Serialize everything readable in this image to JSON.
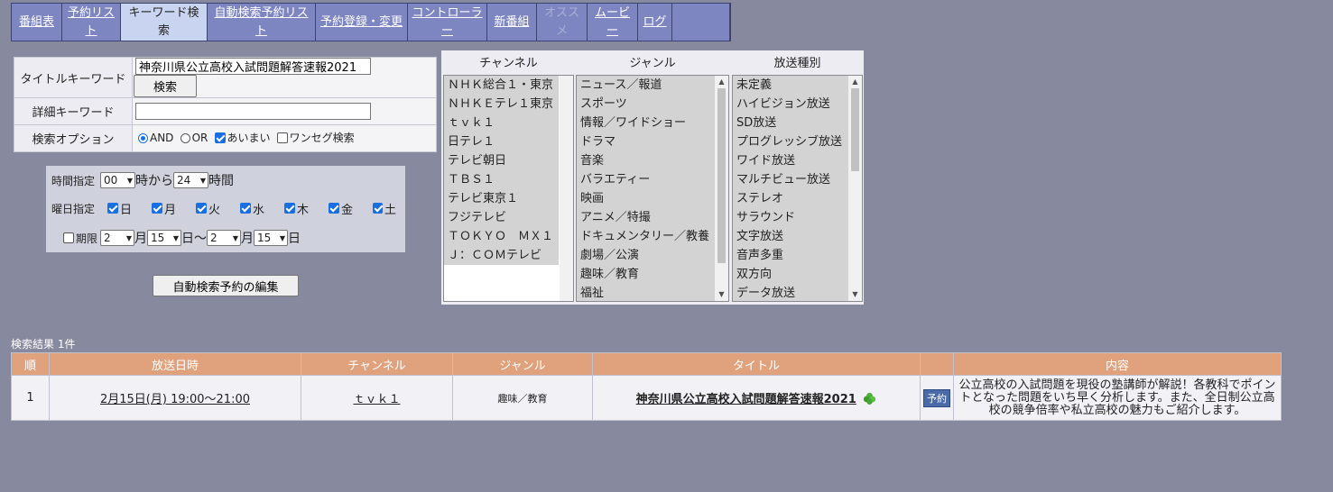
{
  "nav": {
    "tabs": [
      {
        "label": "番組表",
        "width": 56,
        "state": "normal"
      },
      {
        "label": "予約リスト",
        "width": 65,
        "state": "normal"
      },
      {
        "label": "キーワード検索",
        "width": 96,
        "state": "active"
      },
      {
        "label": "自動検索予約リスト",
        "width": 120,
        "state": "normal"
      },
      {
        "label": "予約登録・変更",
        "width": 102,
        "state": "normal"
      },
      {
        "label": "コントローラー",
        "width": 88,
        "state": "normal"
      },
      {
        "label": "新番組",
        "width": 55,
        "state": "normal"
      },
      {
        "label": "オススメ",
        "width": 56,
        "state": "disabled"
      },
      {
        "label": "ムービー",
        "width": 56,
        "state": "normal"
      },
      {
        "label": "ログ",
        "width": 38,
        "state": "normal"
      },
      {
        "label": "",
        "width": 64,
        "state": "blank"
      }
    ]
  },
  "form": {
    "title_label": "タイトルキーワード",
    "title_value": "神奈川県公立高校入試問題解答速報2021",
    "search_button": "検索",
    "detail_label": "詳細キーワード",
    "detail_value": "",
    "option_label": "検索オプション",
    "opt_and": "AND",
    "opt_or": "OR",
    "opt_fuzzy": "あいまい",
    "opt_oneseg": "ワンセグ検索"
  },
  "time": {
    "time_label": "時間指定",
    "from_value": "00",
    "from_suffix": "時から",
    "to_value": "24",
    "to_suffix": "時間",
    "day_label": "曜日指定",
    "days": [
      "日",
      "月",
      "火",
      "水",
      "木",
      "金",
      "土"
    ],
    "limit_label": "期限",
    "start_month": "2",
    "month_suffix": "月",
    "start_day": "15",
    "day_suffix": "日〜",
    "end_month": "2",
    "end_month_suffix": "月",
    "end_day": "15",
    "end_day_suffix": "日"
  },
  "edit_button": "自動検索予約の編集",
  "lists": {
    "channel_header": "チャンネル",
    "genre_header": "ジャンル",
    "type_header": "放送種別",
    "channels": [
      "ＮＨＫ総合１・東京",
      "ＮＨＫＥテレ１東京",
      "ｔｖｋ１",
      "日テレ１",
      "テレビ朝日",
      "ＴＢＳ１",
      "テレビ東京１",
      "フジテレビ",
      "ＴＯＫＹＯ　ＭＸ１",
      "Ｊ：ＣＯＭテレビ"
    ],
    "genres": [
      "ニュース／報道",
      "スポーツ",
      "情報／ワイドショー",
      "ドラマ",
      "音楽",
      "バラエティー",
      "映画",
      "アニメ／特撮",
      "ドキュメンタリー／教養",
      "劇場／公演",
      "趣味／教育",
      "福祉"
    ],
    "types": [
      "未定義",
      "ハイビジョン放送",
      "SD放送",
      "プログレッシブ放送",
      "ワイド放送",
      "マルチビュー放送",
      "ステレオ",
      "サラウンド",
      "文字放送",
      "音声多重",
      "双方向",
      "データ放送"
    ]
  },
  "results": {
    "count_text": "検索結果 1件",
    "headers": [
      "順",
      "放送日時",
      "チャンネル",
      "ジャンル",
      "タイトル",
      "",
      "内容"
    ],
    "rows": [
      {
        "no": "1",
        "datetime": "2月15日(月) 19:00～21:00",
        "channel": "ｔｖｋ１",
        "genre": "趣味／教育",
        "title": "神奈川県公立高校入試問題解答速報2021",
        "reserve": "予約",
        "content": "公立高校の入試問題を現役の塾講師が解説！各教科でポイントとなった問題をいち早く分析します。また、全日制公立高校の競争倍率や私立高校の魅力もご紹介します。"
      }
    ]
  },
  "colors": {
    "background": "#878a9e",
    "nav": "#7d86c0",
    "nav_active": "#c8d4f0",
    "table_header": "#dfa27c",
    "reserve_badge": "#4a6aa8"
  }
}
